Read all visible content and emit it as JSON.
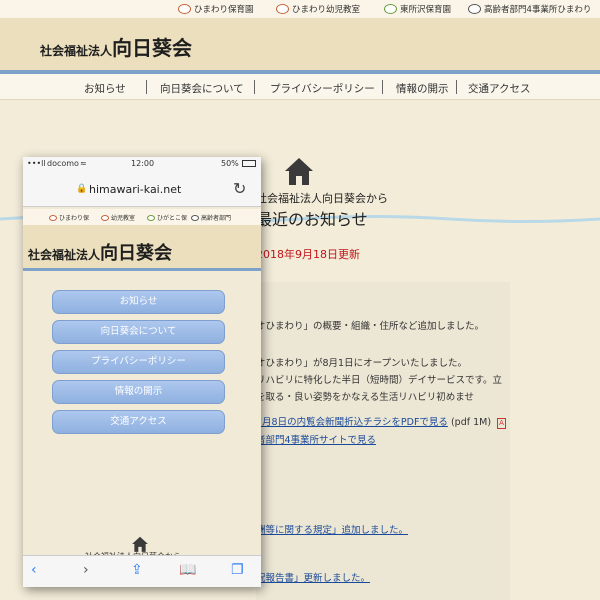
{
  "toplinks": [
    "ひまわり保育園",
    "ひまわり幼児教室",
    "東所沢保育園",
    "高齢者部門4事業所ひまわり"
  ],
  "header": {
    "org_small": "社会福祉法人",
    "org_big": "向日葵会"
  },
  "nav": [
    "お知らせ",
    "向日葵会について",
    "プライバシーポリシー",
    "情報の開示",
    "交通アクセス"
  ],
  "main": {
    "lead": "社会福祉法人向日葵会から",
    "title": "最近のお知らせ",
    "updated": "2018年9月18日更新",
    "news": [
      "オひまわり」の概要・組織・住所など追加しました。",
      "オひまわり」が8月1日にオープンいたしました。",
      "リハビリに特化した半日（短時間）デイサービスです。立",
      "を取る・良い姿勢をかなえる生活リハビリ初めませ",
      "7月8日の内覧会新聞折込チラシをPDFで見る",
      "(pdf 1M)",
      "者部門4事業所サイトで見る",
      "酬等に関する規定」追加しました。",
      "況報告書」更新しました。"
    ]
  },
  "phone": {
    "carrier": "docomo",
    "time": "12:00",
    "battery": "50%",
    "url": "himawari-kai.net",
    "toplinks": [
      "ひまわり保",
      "幼児教室",
      "ひがとこ保",
      "高齢者部門"
    ],
    "org_small": "社会福祉法人",
    "org_big": "向日葵会",
    "menu": [
      "お知らせ",
      "向日葵会について",
      "プライバシーポリシー",
      "情報の開示",
      "交通アクセス"
    ],
    "footer_text": "社会福祉法人向日葵会から"
  }
}
